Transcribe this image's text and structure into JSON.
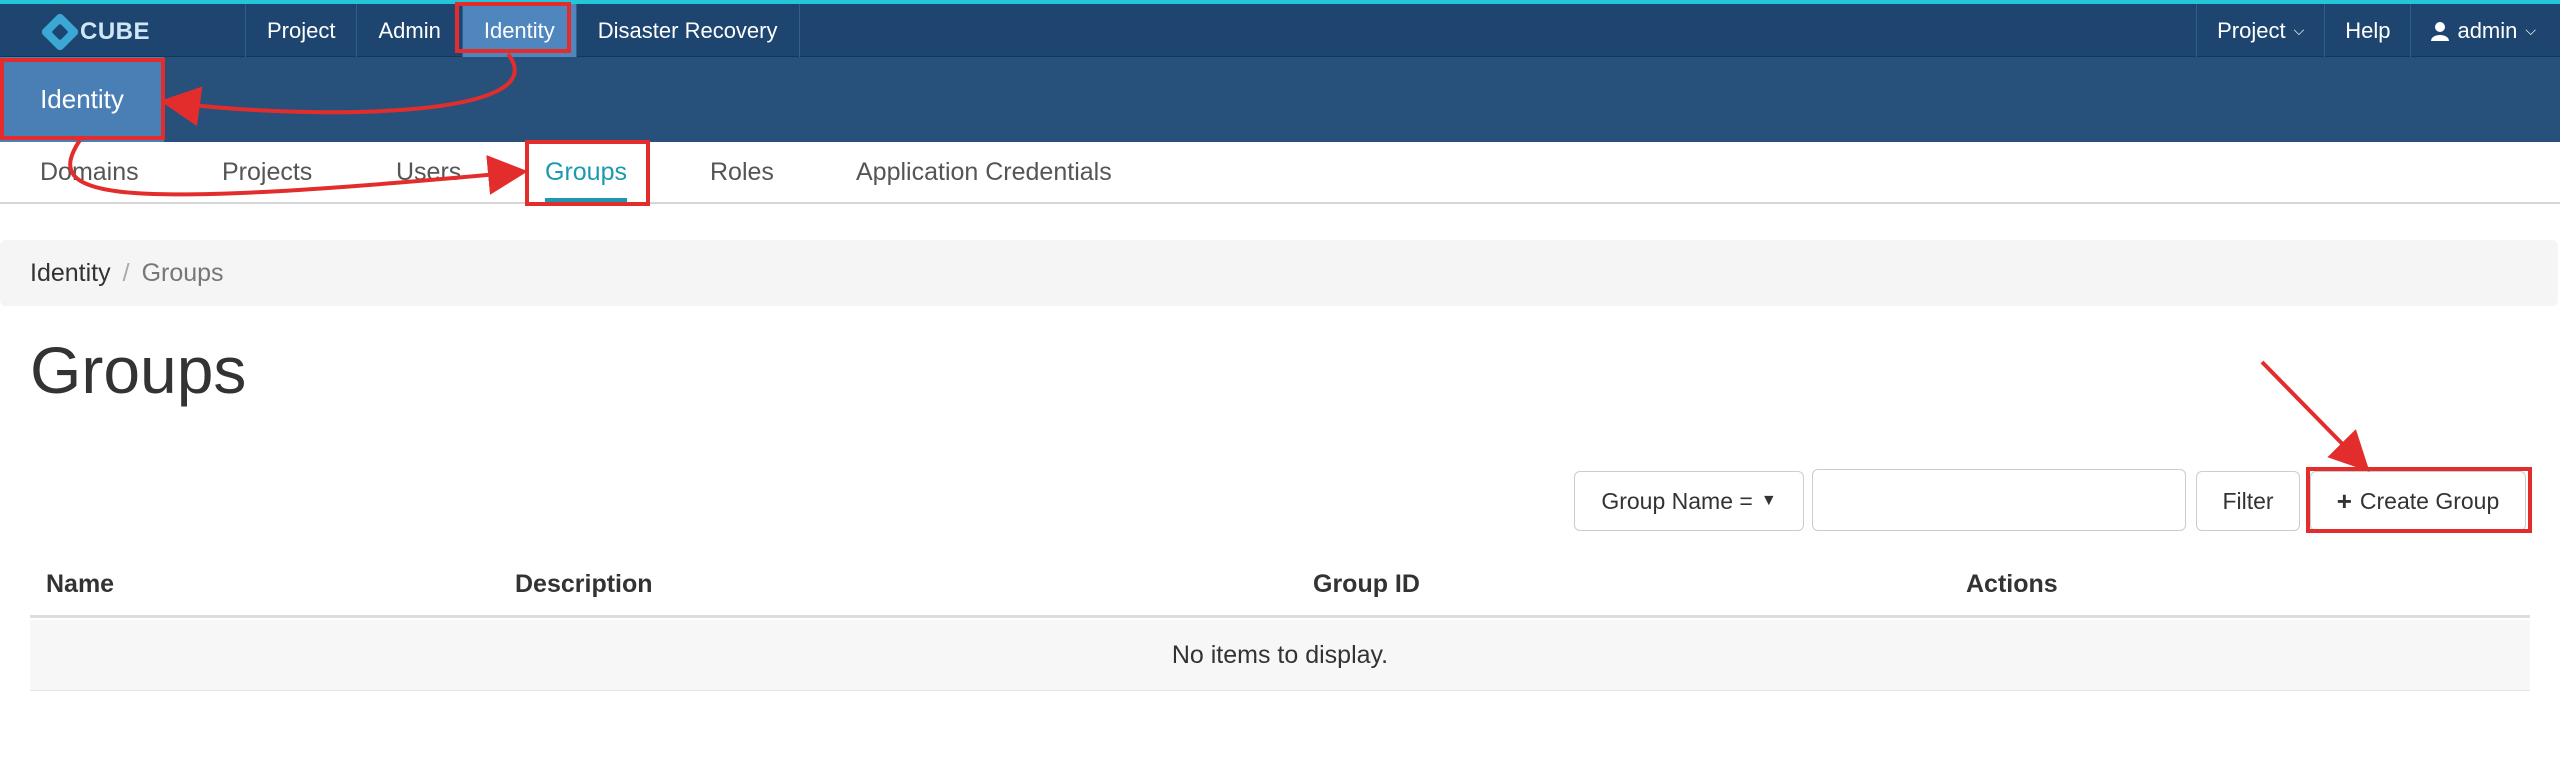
{
  "brand": {
    "name": "CUBE"
  },
  "topnav": {
    "items": [
      {
        "label": "Project"
      },
      {
        "label": "Admin"
      },
      {
        "label": "Identity"
      },
      {
        "label": "Disaster Recovery"
      }
    ],
    "right": {
      "project": "Project",
      "help": "Help",
      "user": "admin"
    }
  },
  "section": {
    "label": "Identity"
  },
  "tabs": [
    {
      "label": "Domains"
    },
    {
      "label": "Projects"
    },
    {
      "label": "Users"
    },
    {
      "label": "Groups"
    },
    {
      "label": "Roles"
    },
    {
      "label": "Application Credentials"
    }
  ],
  "breadcrumb": {
    "first": "Identity",
    "separator": "/",
    "current": "Groups"
  },
  "page": {
    "title": "Groups"
  },
  "filter": {
    "field_label": "Group Name =",
    "input_value": "",
    "filter_label": "Filter",
    "create_label": "Create Group"
  },
  "table": {
    "columns": [
      "Name",
      "Description",
      "Group ID",
      "Actions"
    ],
    "empty_text": "No items to display."
  },
  "colors": {
    "navbar": "#1e4570",
    "accent_bar": "#26c6da",
    "active_tab": "#1a9ab0",
    "annotation": "#e32d2d"
  }
}
